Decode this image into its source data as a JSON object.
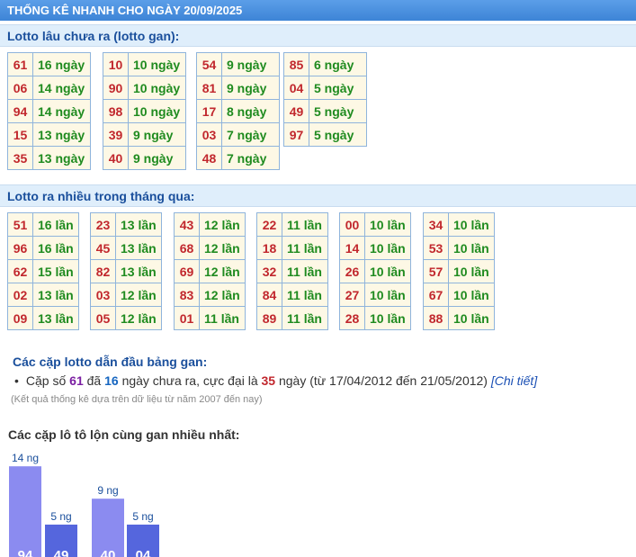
{
  "header": {
    "title": "THỐNG KÊ NHANH CHO NGÀY 20/09/2025"
  },
  "gan": {
    "title": "Lotto lâu chưa ra (lotto gan):",
    "columns": [
      [
        [
          "61",
          "16 ngày"
        ],
        [
          "06",
          "14 ngày"
        ],
        [
          "94",
          "14 ngày"
        ],
        [
          "15",
          "13 ngày"
        ],
        [
          "35",
          "13 ngày"
        ]
      ],
      [
        [
          "10",
          "10 ngày"
        ],
        [
          "90",
          "10 ngày"
        ],
        [
          "98",
          "10 ngày"
        ],
        [
          "39",
          "9 ngày"
        ],
        [
          "40",
          "9 ngày"
        ]
      ],
      [
        [
          "54",
          "9 ngày"
        ],
        [
          "81",
          "9 ngày"
        ],
        [
          "17",
          "8 ngày"
        ],
        [
          "03",
          "7 ngày"
        ],
        [
          "48",
          "7 ngày"
        ]
      ],
      [
        [
          "85",
          "6 ngày"
        ],
        [
          "04",
          "5 ngày"
        ],
        [
          "49",
          "5 ngày"
        ],
        [
          "97",
          "5 ngày"
        ]
      ]
    ]
  },
  "nhieu": {
    "title": "Lotto ra nhiều trong tháng qua:",
    "columns": [
      [
        [
          "51",
          "16 lần"
        ],
        [
          "96",
          "16 lần"
        ],
        [
          "62",
          "15 lần"
        ],
        [
          "02",
          "13 lần"
        ],
        [
          "09",
          "13 lần"
        ]
      ],
      [
        [
          "23",
          "13 lần"
        ],
        [
          "45",
          "13 lần"
        ],
        [
          "82",
          "13 lần"
        ],
        [
          "03",
          "12 lần"
        ],
        [
          "05",
          "12 lần"
        ]
      ],
      [
        [
          "43",
          "12 lần"
        ],
        [
          "68",
          "12 lần"
        ],
        [
          "69",
          "12 lần"
        ],
        [
          "83",
          "12 lần"
        ],
        [
          "01",
          "11 lần"
        ]
      ],
      [
        [
          "22",
          "11 lần"
        ],
        [
          "18",
          "11 lần"
        ],
        [
          "32",
          "11 lần"
        ],
        [
          "84",
          "11 lần"
        ],
        [
          "89",
          "11 lần"
        ]
      ],
      [
        [
          "00",
          "10 lần"
        ],
        [
          "14",
          "10 lần"
        ],
        [
          "26",
          "10 lần"
        ],
        [
          "27",
          "10 lần"
        ],
        [
          "28",
          "10 lần"
        ]
      ],
      [
        [
          "34",
          "10 lần"
        ],
        [
          "53",
          "10 lần"
        ],
        [
          "57",
          "10 lần"
        ],
        [
          "67",
          "10 lần"
        ],
        [
          "88",
          "10 lần"
        ]
      ]
    ]
  },
  "lead": {
    "title": "Các cặp lotto dẫn đầu bảng gan:",
    "prefix": "Cặp số",
    "number": "61",
    "mid1": "đã",
    "days": "16",
    "mid2": "ngày chưa ra, cực đại là",
    "max": "35",
    "suffix": "ngày (từ 17/04/2012 đến 21/05/2012)",
    "link": "[Chi tiết]",
    "note": "(Kết quả thống kê dựa trên dữ liệu từ năm 2007 đến nay)"
  },
  "chart_title": "Các cặp lô tô lộn cùng gan nhiều nhất:",
  "chart_data": {
    "type": "bar",
    "categories": [
      "94",
      "49",
      "40",
      "04"
    ],
    "values": [
      14,
      5,
      9,
      5
    ],
    "value_labels": [
      "14 ng",
      "5 ng",
      "9 ng",
      "5 ng"
    ],
    "colors": [
      "#8b8bf0",
      "#5566dd",
      "#8b8bf0",
      "#5566dd"
    ]
  }
}
